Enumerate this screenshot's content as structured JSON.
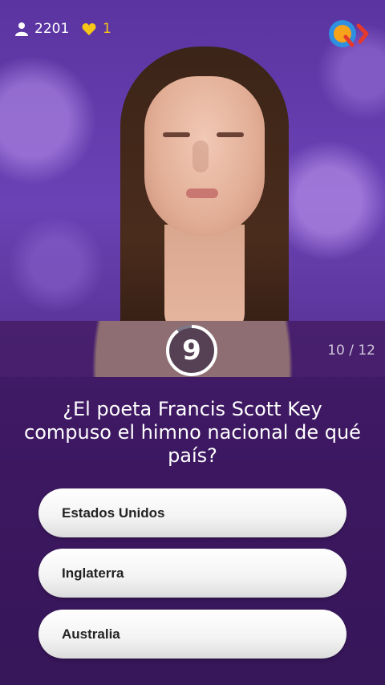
{
  "header": {
    "viewer_count": "2201",
    "lives_count": "1",
    "viewer_icon": "person-icon",
    "lives_icon": "heart-icon",
    "logo_icon": "q-logo-icon",
    "colors": {
      "lives": "#f5c518",
      "logo_blue": "#2f8fe0",
      "logo_orange": "#f7a21b",
      "logo_red": "#e4392b"
    }
  },
  "timer": {
    "seconds": "9",
    "fraction_remaining": 0.9
  },
  "progress": {
    "current": "10",
    "separator": "/",
    "total": "12",
    "text": "10 / 12"
  },
  "question": {
    "text": "¿El poeta Francis Scott Key compuso el himno nacional de qué país?"
  },
  "answers": [
    {
      "label": "Estados Unidos"
    },
    {
      "label": "Inglaterra"
    },
    {
      "label": "Australia"
    }
  ]
}
